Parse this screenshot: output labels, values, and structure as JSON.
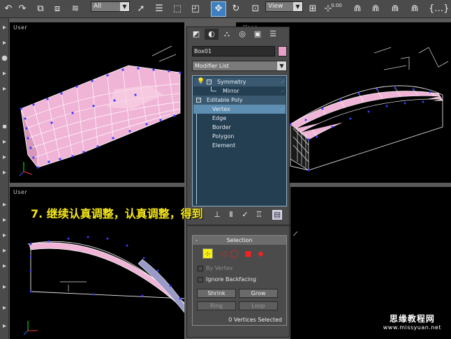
{
  "toolbar": {
    "selection_filter": "All",
    "ref_coord_system": "View",
    "spinner_value": "0.00"
  },
  "viewports": {
    "top_left_label": "User",
    "top_right_label": "User",
    "bottom_left_label": "User"
  },
  "command_panel": {
    "object_name": "Box01",
    "object_color": "#e7a0c6",
    "modifier_list": "Modifier List",
    "stack": [
      {
        "label": "Symmetry"
      },
      {
        "label": "Mirror"
      },
      {
        "label": "Editable Poly"
      },
      {
        "label": "Vertex"
      },
      {
        "label": "Edge"
      },
      {
        "label": "Border"
      },
      {
        "label": "Polygon"
      },
      {
        "label": "Element"
      }
    ],
    "selection_rollout": {
      "minus": "-",
      "title": "Selection",
      "by_vertex": "By Vertex",
      "ignore_backfacing": "Ignore Backfacing",
      "shrink": "Shrink",
      "grow": "Grow",
      "ring": "Ring",
      "loop": "Loop",
      "status": "0 Vertices Selected"
    }
  },
  "caption": "7. 继续认真调整，认真调整，得到",
  "watermark": {
    "line1": "思缘教程网",
    "line2": "www.missyuan.net"
  },
  "colors": {
    "mesh_pink": "#f0b4d6",
    "selection_yellow": "#f8f00f",
    "vertex_blue": "#3a3aff",
    "stack_highlight": "#5e8fb2"
  }
}
